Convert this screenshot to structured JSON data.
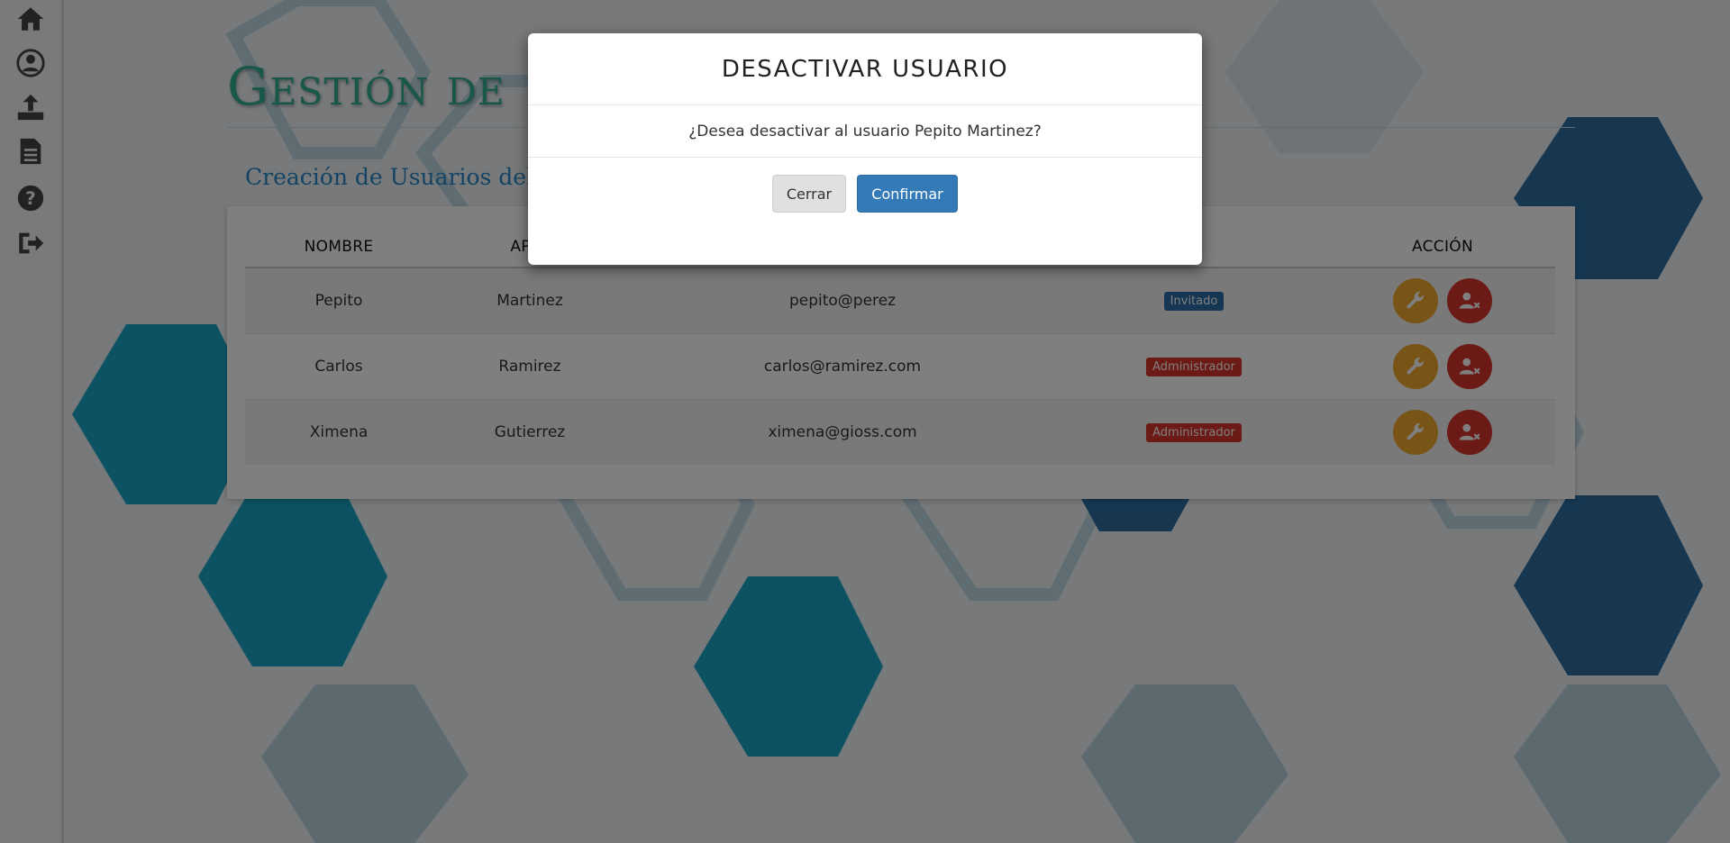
{
  "colors": {
    "title": "#33b091",
    "subtitle": "#2b87c9",
    "invitado_badge": "#2b6ea8",
    "admin_badge": "#d9342b",
    "edit_button": "#f0a92c",
    "deactivate_button": "#d9342b",
    "confirm_button": "#337ab7"
  },
  "sidebar": {
    "icons": [
      "home-icon",
      "user-icon",
      "upload-icon",
      "document-icon",
      "help-icon",
      "logout-icon"
    ]
  },
  "page": {
    "title": "Gestión de",
    "subtitle": "Creación de Usuarios del Ap"
  },
  "table": {
    "headers": [
      "NOMBRE",
      "APEL",
      "",
      "",
      "ACCIÓN"
    ],
    "rows": [
      {
        "nombre": "Pepito",
        "apellido": "Martinez",
        "email": "pepito@perez",
        "rol": "Invitado"
      },
      {
        "nombre": "Carlos",
        "apellido": "Ramirez",
        "email": "carlos@ramirez.com",
        "rol": "Administrador"
      },
      {
        "nombre": "Ximena",
        "apellido": "Gutierrez",
        "email": "ximena@gioss.com",
        "rol": "Administrador"
      }
    ]
  },
  "modal": {
    "title": "DESACTIVAR USUARIO",
    "message": "¿Desea desactivar al usuario Pepito Martinez?",
    "close_label": "Cerrar",
    "confirm_label": "Confirmar"
  }
}
